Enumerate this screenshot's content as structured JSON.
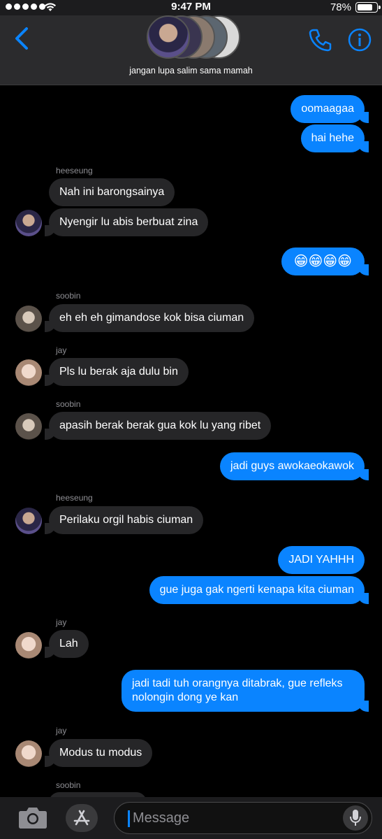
{
  "status": {
    "time": "9:47 PM",
    "battery": "78%"
  },
  "header": {
    "title": "jangan lupa salim sama mamah"
  },
  "messages": [
    {
      "text": "oomaagaa"
    },
    {
      "text": "hai hehe"
    },
    {
      "sender": "heeseung",
      "text": "Nah ini barongsainya"
    },
    {
      "text": "Nyengir lu abis berbuat zina"
    },
    {
      "text": "😁😁😁😁"
    },
    {
      "sender": "soobin",
      "text": "eh eh eh gimandose kok bisa ciuman"
    },
    {
      "sender": "jay",
      "text": "Pls lu berak aja dulu bin"
    },
    {
      "sender": "soobin",
      "text": "apasih berak berak gua kok lu yang ribet"
    },
    {
      "text": "jadi guys awokaeokawok"
    },
    {
      "sender": "heeseung",
      "text": "Perilaku orgil habis ciuman"
    },
    {
      "text": "JADI YAHHH"
    },
    {
      "text": "gue juga gak ngerti kenapa kita ciuman"
    },
    {
      "sender": "jay",
      "text": "Lah"
    },
    {
      "text": "jadi tadi tuh orangnya ditabrak, gue refleks nolongin dong ye kan"
    },
    {
      "sender": "jay",
      "text": "Modus tu modus"
    },
    {
      "sender": "soobin"
    }
  ],
  "compose": {
    "placeholder": "Message"
  },
  "colors": {
    "outgoing": "#0a84ff",
    "incoming": "#262628",
    "accent": "#0a84ff"
  },
  "icons": {
    "back": "chevron-left-icon",
    "phone": "phone-icon",
    "info": "info-icon",
    "camera": "camera-icon",
    "appstore": "app-store-icon",
    "mic": "microphone-icon"
  }
}
